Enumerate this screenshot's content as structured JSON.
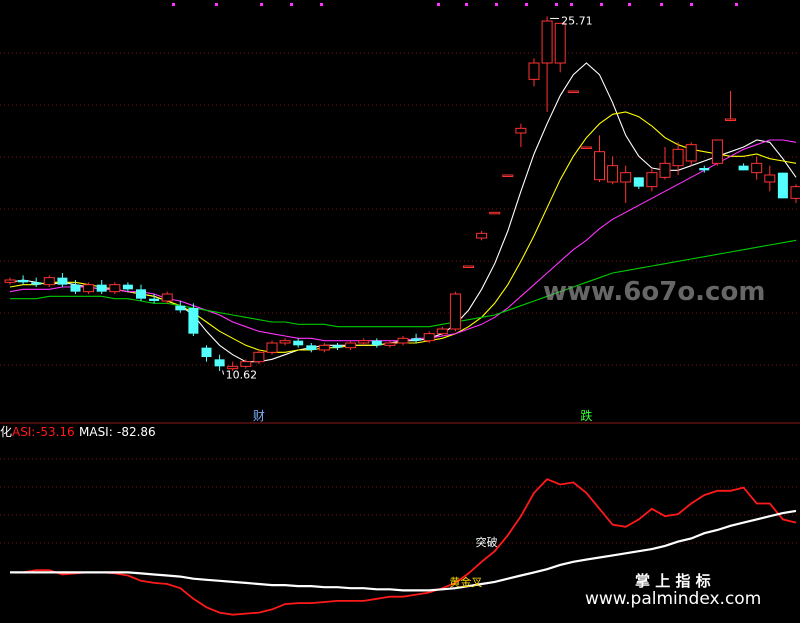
{
  "chart_data": [
    {
      "type": "candlestick",
      "panel": "price",
      "grid": true,
      "ylim": [
        8.5,
        26.5
      ],
      "x_count": 61,
      "candles": [
        [
          14.4,
          14.6,
          14.3,
          14.5
        ],
        [
          14.5,
          14.7,
          14.3,
          14.4
        ],
        [
          14.4,
          14.6,
          14.2,
          14.3
        ],
        [
          14.3,
          14.7,
          14.2,
          14.6
        ],
        [
          14.6,
          14.8,
          14.2,
          14.3
        ],
        [
          14.3,
          14.5,
          13.9,
          14.0
        ],
        [
          14.0,
          14.4,
          13.9,
          14.3
        ],
        [
          14.3,
          14.5,
          13.9,
          14.0
        ],
        [
          14.0,
          14.4,
          13.9,
          14.3
        ],
        [
          14.3,
          14.4,
          14.0,
          14.1
        ],
        [
          14.1,
          14.3,
          13.6,
          13.7
        ],
        [
          13.7,
          13.9,
          13.5,
          13.6
        ],
        [
          13.6,
          14.0,
          13.5,
          13.9
        ],
        [
          13.4,
          13.6,
          13.1,
          13.2
        ],
        [
          13.3,
          13.5,
          12.1,
          12.2
        ],
        [
          11.6,
          11.7,
          11.0,
          11.2
        ],
        [
          11.1,
          11.3,
          10.6,
          10.8
        ],
        [
          10.7,
          11.0,
          10.6,
          10.8
        ],
        [
          10.8,
          11.1,
          10.7,
          11.0
        ],
        [
          11.0,
          11.5,
          10.9,
          11.4
        ],
        [
          11.4,
          11.9,
          11.3,
          11.8
        ],
        [
          11.8,
          12.0,
          11.7,
          11.9
        ],
        [
          11.9,
          12.0,
          11.6,
          11.7
        ],
        [
          11.7,
          11.8,
          11.4,
          11.5
        ],
        [
          11.5,
          11.8,
          11.4,
          11.7
        ],
        [
          11.7,
          11.8,
          11.5,
          11.6
        ],
        [
          11.6,
          11.9,
          11.5,
          11.8
        ],
        [
          11.8,
          12.0,
          11.7,
          11.9
        ],
        [
          11.9,
          12.0,
          11.6,
          11.7
        ],
        [
          11.7,
          11.9,
          11.6,
          11.8
        ],
        [
          11.8,
          12.1,
          11.7,
          12.0
        ],
        [
          12.0,
          12.2,
          11.8,
          11.9
        ],
        [
          11.9,
          12.3,
          11.8,
          12.2
        ],
        [
          12.2,
          12.5,
          12.1,
          12.4
        ],
        [
          12.4,
          14.0,
          12.3,
          13.9
        ],
        [
          15.1,
          15.1,
          15.1,
          15.1
        ],
        [
          16.3,
          16.6,
          16.2,
          16.5
        ],
        [
          17.4,
          17.4,
          17.4,
          17.4
        ],
        [
          19.0,
          19.0,
          19.0,
          19.0
        ],
        [
          20.8,
          21.2,
          20.2,
          21.0
        ],
        [
          23.1,
          24.0,
          22.8,
          23.8
        ],
        [
          23.8,
          25.8,
          21.7,
          25.6
        ],
        [
          23.8,
          25.5,
          23.4,
          25.5
        ],
        [
          22.6,
          22.6,
          22.6,
          22.6
        ],
        [
          20.2,
          20.2,
          20.2,
          20.2
        ],
        [
          18.8,
          20.7,
          18.7,
          20.0
        ],
        [
          18.7,
          19.8,
          18.6,
          19.4
        ],
        [
          18.7,
          19.4,
          17.8,
          19.1
        ],
        [
          18.9,
          18.9,
          18.4,
          18.5
        ],
        [
          18.5,
          19.3,
          18.3,
          19.1
        ],
        [
          18.9,
          20.2,
          18.8,
          19.5
        ],
        [
          19.4,
          20.4,
          19.0,
          20.1
        ],
        [
          19.6,
          20.4,
          19.4,
          20.3
        ],
        [
          19.3,
          19.4,
          19.1,
          19.2
        ],
        [
          19.5,
          20.5,
          19.4,
          20.5
        ],
        [
          21.4,
          22.6,
          21.3,
          21.4
        ],
        [
          19.4,
          19.5,
          19.2,
          19.2
        ],
        [
          19.1,
          19.8,
          18.8,
          19.5
        ],
        [
          18.7,
          19.4,
          18.3,
          19.0
        ],
        [
          19.1,
          19.1,
          18.0,
          18.0
        ],
        [
          18.0,
          18.6,
          17.8,
          18.5
        ]
      ],
      "series": [
        {
          "color": "#ffffff",
          "values": [
            14.4,
            14.5,
            14.4,
            14.3,
            14.4,
            14.3,
            14.2,
            14.1,
            14.1,
            14.0,
            13.9,
            13.8,
            13.6,
            13.4,
            13.0,
            12.3,
            11.7,
            11.3,
            11.0,
            11.0,
            11.1,
            11.3,
            11.5,
            11.6,
            11.7,
            11.7,
            11.7,
            11.7,
            11.7,
            11.8,
            11.9,
            11.9,
            12.0,
            12.2,
            12.6,
            13.2,
            14.1,
            15.2,
            16.6,
            18.3,
            19.9,
            21.2,
            22.4,
            23.3,
            23.8,
            23.3,
            22.1,
            20.7,
            19.8,
            19.3,
            19.2,
            19.2,
            19.4,
            19.6,
            19.8,
            20.0,
            20.2,
            20.5,
            20.4,
            19.7,
            18.9
          ]
        },
        {
          "color": "#ffff00",
          "values": [
            14.2,
            14.3,
            14.3,
            14.4,
            14.4,
            14.4,
            14.3,
            14.2,
            14.1,
            14.0,
            13.9,
            13.8,
            13.6,
            13.4,
            13.1,
            12.7,
            12.3,
            12.0,
            11.7,
            11.5,
            11.4,
            11.4,
            11.5,
            11.5,
            11.6,
            11.6,
            11.7,
            11.7,
            11.7,
            11.8,
            11.8,
            11.8,
            11.9,
            12.0,
            12.2,
            12.5,
            12.9,
            13.5,
            14.3,
            15.3,
            16.4,
            17.6,
            18.8,
            19.8,
            20.6,
            21.2,
            21.6,
            21.7,
            21.5,
            21.1,
            20.6,
            20.3,
            20.1,
            20.0,
            19.9,
            19.8,
            19.8,
            19.9,
            19.7,
            19.6,
            19.5
          ]
        },
        {
          "color": "#ff33ff",
          "values": [
            14.0,
            14.1,
            14.1,
            14.1,
            14.2,
            14.2,
            14.2,
            14.1,
            14.1,
            14.0,
            14.0,
            13.9,
            13.7,
            13.6,
            13.4,
            13.2,
            13.0,
            12.7,
            12.5,
            12.3,
            12.2,
            12.1,
            12.0,
            12.0,
            11.9,
            11.9,
            11.9,
            11.9,
            11.9,
            11.9,
            11.9,
            12.0,
            12.0,
            12.1,
            12.2,
            12.4,
            12.6,
            12.9,
            13.3,
            13.8,
            14.3,
            14.8,
            15.3,
            15.8,
            16.2,
            16.7,
            17.1,
            17.4,
            17.7,
            18.0,
            18.3,
            18.6,
            18.9,
            19.2,
            19.5,
            19.8,
            20.1,
            20.3,
            20.5,
            20.5,
            20.4
          ]
        },
        {
          "color": "#00cc00",
          "values": [
            13.7,
            13.7,
            13.7,
            13.8,
            13.8,
            13.8,
            13.8,
            13.8,
            13.7,
            13.7,
            13.6,
            13.5,
            13.5,
            13.4,
            13.3,
            13.2,
            13.1,
            13.0,
            12.9,
            12.8,
            12.7,
            12.7,
            12.6,
            12.6,
            12.6,
            12.5,
            12.5,
            12.5,
            12.5,
            12.5,
            12.5,
            12.5,
            12.5,
            12.6,
            12.7,
            12.8,
            12.9,
            13.0,
            13.2,
            13.4,
            13.6,
            13.8,
            14.0,
            14.2,
            14.4,
            14.6,
            14.8,
            14.9,
            15.0,
            15.1,
            15.2,
            15.3,
            15.4,
            15.5,
            15.6,
            15.7,
            15.8,
            15.9,
            16.0,
            16.1,
            16.2
          ]
        }
      ],
      "annotations": [
        {
          "text": "25.71",
          "x": 41,
          "y": 25.71
        },
        {
          "text": "10.62",
          "x": 16,
          "y": 10.62
        },
        {
          "text": "财",
          "x": 19
        },
        {
          "text": "跌",
          "x": 44
        }
      ]
    },
    {
      "type": "line",
      "panel": "indicator",
      "title": "ASI",
      "ylim": [
        -100,
        70
      ],
      "x_count": 61,
      "series": [
        {
          "name": "ASI",
          "value_label": "-53.16",
          "color": "#ff1a1a",
          "values": [
            -55,
            -55,
            -53,
            -53,
            -57,
            -56,
            -55,
            -55,
            -56,
            -58,
            -63,
            -65,
            -66,
            -70,
            -80,
            -88,
            -93,
            -95,
            -94,
            -93,
            -90,
            -85,
            -84,
            -84,
            -83,
            -82,
            -82,
            -82,
            -80,
            -78,
            -78,
            -76,
            -74,
            -70,
            -65,
            -56,
            -45,
            -35,
            -20,
            -2,
            20,
            33,
            28,
            30,
            20,
            5,
            -10,
            -12,
            -5,
            5,
            -2,
            0,
            10,
            18,
            22,
            22,
            25,
            10,
            10,
            -5,
            -8
          ]
        },
        {
          "name": "MASI",
          "value_label": "-82.86",
          "color": "#ffffff",
          "values": [
            -55,
            -55,
            -55,
            -55,
            -55,
            -55,
            -55,
            -55,
            -55,
            -55,
            -56,
            -57,
            -58,
            -59,
            -61,
            -62,
            -63,
            -64,
            -65,
            -66,
            -67,
            -67,
            -68,
            -68,
            -69,
            -69,
            -70,
            -70,
            -71,
            -71,
            -72,
            -72,
            -72,
            -71,
            -70,
            -68,
            -66,
            -64,
            -61,
            -58,
            -55,
            -52,
            -48,
            -45,
            -43,
            -41,
            -39,
            -37,
            -35,
            -33,
            -30,
            -26,
            -23,
            -18,
            -15,
            -11,
            -8,
            -5,
            -2,
            1,
            3
          ]
        }
      ],
      "annotations": [
        {
          "text": "突破",
          "x": 36,
          "y": -30
        },
        {
          "text": "黄金叉",
          "x": 34,
          "y": -68
        }
      ]
    }
  ],
  "indicator_header": {
    "prefix": "化",
    "asi_label": "ASI:",
    "asi_value": "-53.16",
    "masi_label": "MASI:",
    "masi_value": "-82.86"
  },
  "watermarks": {
    "top": "www.6o7o.com",
    "bottom_cn": "掌 上 指 标",
    "bottom_url": "www.palmindex.com"
  }
}
